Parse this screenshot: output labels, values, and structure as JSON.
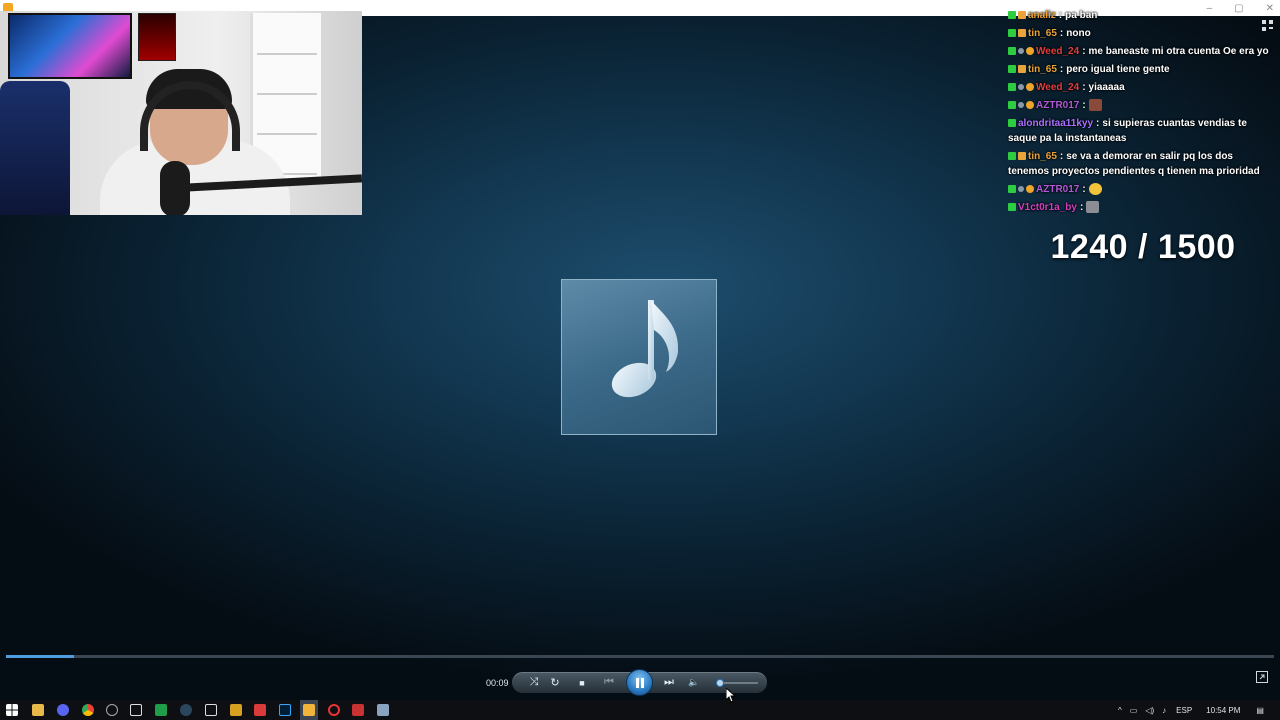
{
  "window": {
    "controls": [
      "–",
      "▢",
      "✕"
    ]
  },
  "chat": {
    "messages": [
      {
        "user": "analiz",
        "user_color": "#e8a33a",
        "text": "pa ban",
        "badges": [
          "green",
          "sub"
        ]
      },
      {
        "user": "tin_65",
        "user_color": "#e8a33a",
        "text": "nono",
        "badges": [
          "green",
          "sub"
        ]
      },
      {
        "user": "Weed_24",
        "user_color": "#e23d3d",
        "text": "me baneaste mi otra cuenta Oe era yo",
        "badges": [
          "green",
          "sword",
          "gold"
        ]
      },
      {
        "user": "tin_65",
        "user_color": "#e8a33a",
        "text": "pero igual tiene gente",
        "badges": [
          "green",
          "sub"
        ]
      },
      {
        "user": "Weed_24",
        "user_color": "#e23d3d",
        "text": "yiaaaaa",
        "badges": [
          "green",
          "sword",
          "gold"
        ]
      },
      {
        "user": "AZTR017",
        "user_color": "#b05ad6",
        "text": "",
        "badges": [
          "green",
          "sword",
          "gold"
        ],
        "emote": "brown"
      },
      {
        "user": "alondritaa11kyy",
        "user_color": "#a970ff",
        "text": "si supieras cuantas vendias te saque pa la instantaneas",
        "badges": [
          "green"
        ]
      },
      {
        "user": "tin_65",
        "user_color": "#e8a33a",
        "text": "se va a demorar en salir pq los dos tenemos proyectos pendientes q tienen ma prioridad",
        "badges": [
          "green",
          "sub"
        ]
      },
      {
        "user": "AZTR017",
        "user_color": "#b05ad6",
        "text": "",
        "badges": [
          "green",
          "sword",
          "gold"
        ],
        "emote": "face"
      },
      {
        "user": "V1ct0r1a_by",
        "user_color": "#d23fc0",
        "text": "",
        "badges": [
          "green"
        ],
        "emote": "grey"
      }
    ],
    "separator": ":"
  },
  "counter": "1240 / 1500",
  "player": {
    "time": "00:09",
    "progress": 0.054,
    "volume": 0.1,
    "buttons": {
      "shuffle": "⤨",
      "repeat": "↻",
      "stop": "■",
      "previous": "⏮",
      "play_pause": "⏸",
      "next": "⏭",
      "mute": "🔈"
    }
  },
  "taskbar": {
    "language": "ESP",
    "clock": "10:54 PM"
  },
  "colors": {
    "accent": "#4d9de0",
    "background": "#123750",
    "taskbar": "#0d0f12"
  }
}
